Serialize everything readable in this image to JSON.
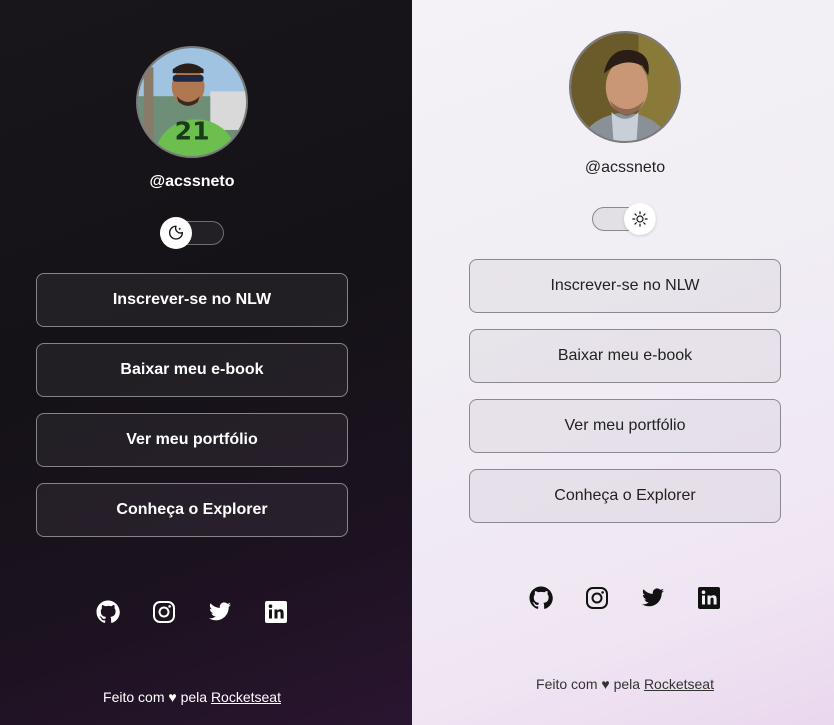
{
  "themes": [
    {
      "mode": "dark",
      "handle": "@acssneto",
      "toggle_icon": "moon-icon",
      "links": [
        "Inscrever-se no NLW",
        "Baixar meu e-book",
        "Ver meu portfólio",
        "Conheça o Explorer"
      ],
      "socials": [
        "github-icon",
        "instagram-icon",
        "twitter-icon",
        "linkedin-icon"
      ],
      "footer": {
        "prefix": "Feito com",
        "heart": "♥",
        "middle": "pela",
        "brand": "Rocketseat"
      }
    },
    {
      "mode": "light",
      "handle": "@acssneto",
      "toggle_icon": "sun-icon",
      "links": [
        "Inscrever-se no NLW",
        "Baixar meu e-book",
        "Ver meu portfólio",
        "Conheça o Explorer"
      ],
      "socials": [
        "github-icon",
        "instagram-icon",
        "twitter-icon",
        "linkedin-icon"
      ],
      "footer": {
        "prefix": "Feito com",
        "heart": "♥",
        "middle": "pela",
        "brand": "Rocketseat"
      }
    }
  ],
  "colors": {
    "dark_bg": "#141216",
    "light_bg": "#f2f0f5",
    "accent_gradient_end": "#2a1530"
  }
}
